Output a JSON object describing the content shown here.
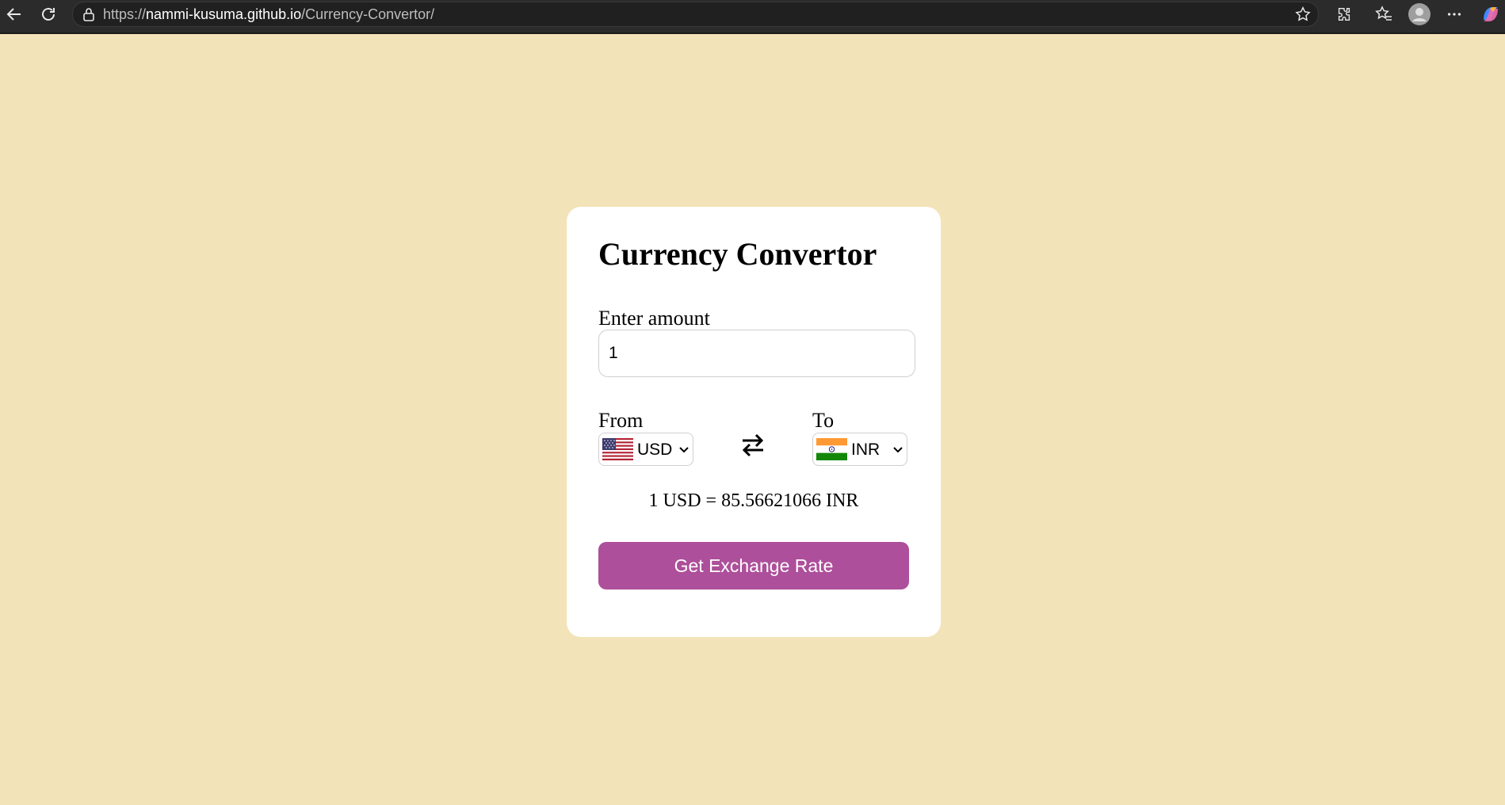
{
  "browser": {
    "url_prefix": "https://",
    "url_host": "nammi-kusuma.github.io",
    "url_path": "/Currency-Convertor/"
  },
  "icons": {
    "back": "back-arrow-icon",
    "refresh": "refresh-icon",
    "site_info": "lock-icon",
    "favorite": "star-icon",
    "extensions": "puzzle-icon",
    "favorites": "favorites-icon",
    "profile": "avatar-icon",
    "more": "more-icon",
    "copilot": "copilot-icon",
    "swap": "swap-arrows-icon",
    "from_flag": "us-flag-icon",
    "to_flag": "india-flag-icon"
  },
  "converter": {
    "title": "Currency Convertor",
    "amount_label": "Enter amount",
    "amount_value": "1",
    "from_label": "From",
    "from_currency": "USD",
    "to_label": "To",
    "to_currency": "INR",
    "result_text": "1 USD = 85.56621066 INR",
    "button_label": "Get Exchange Rate"
  },
  "colors": {
    "page_background": "#f3e3b8",
    "card_background": "#ffffff",
    "button_background": "#ad4f9a",
    "button_text": "#ffffff"
  }
}
